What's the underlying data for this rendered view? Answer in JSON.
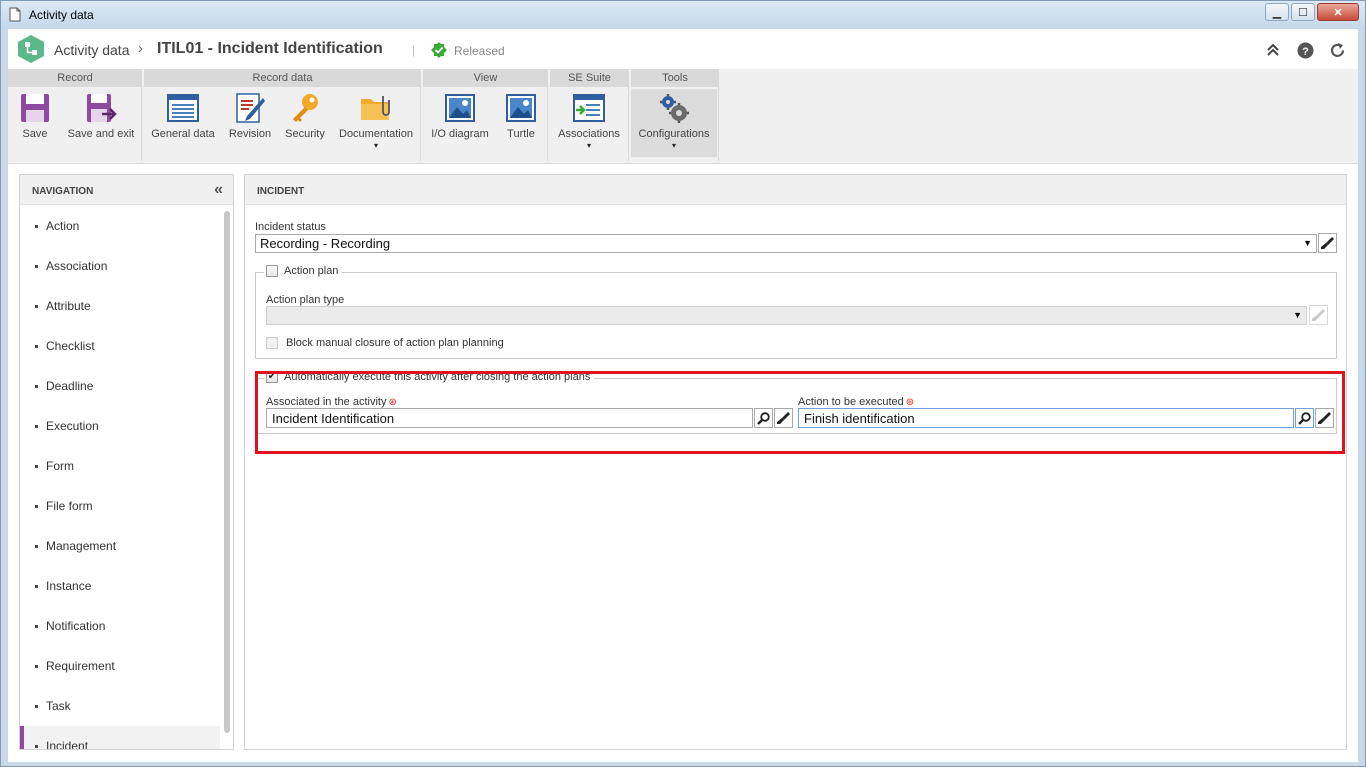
{
  "window": {
    "title": "Activity data",
    "minimize": "▁",
    "maximize": "☐",
    "close": "✕"
  },
  "header": {
    "crumb_root": "Activity data",
    "separator": "›",
    "title": "ITIL01 - Incident Identification",
    "divider": "|",
    "status": "Released",
    "status_color": "#3aaa35"
  },
  "ribbon": {
    "groups": [
      {
        "label": "Record"
      },
      {
        "label": "Record data"
      },
      {
        "label": "View"
      },
      {
        "label": "SE Suite"
      },
      {
        "label": "Tools"
      }
    ],
    "buttons": {
      "save": "Save",
      "save_exit": "Save and exit",
      "general_data": "General data",
      "revision": "Revision",
      "security": "Security",
      "documentation": "Documentation",
      "io_diagram": "I/O diagram",
      "turtle": "Turtle",
      "associations": "Associations",
      "configurations": "Configurations"
    },
    "caret": "▾"
  },
  "navigation": {
    "header": "NAVIGATION",
    "collapse": "«",
    "items": [
      "Action",
      "Association",
      "Attribute",
      "Checklist",
      "Deadline",
      "Execution",
      "Form",
      "File form",
      "Management",
      "Instance",
      "Notification",
      "Requirement",
      "Task",
      "Incident"
    ],
    "active_item": "Incident"
  },
  "incident": {
    "header": "INCIDENT",
    "status_label": "Incident status",
    "status_value": "Recording - Recording",
    "action_plan_label": "Action plan",
    "action_plan_checked": false,
    "action_plan_type_label": "Action plan type",
    "action_plan_type_value": "",
    "block_manual_label": "Block manual closure of action plan planning",
    "auto_execute_label": "Automatically execute this activity after closing the action plans",
    "auto_execute_checked": true,
    "associated_label": "Associated in the activity",
    "associated_value": "Incident Identification",
    "action_label": "Action to be executed",
    "action_value": "Finish identification",
    "required_mark": "⊛",
    "check_mark": "✔",
    "dropdown_arrow": "▼"
  },
  "colors": {
    "accent": "#8e4a9e",
    "highlight": "#e0121f",
    "ribbon_bg": "#f0f0f0"
  }
}
